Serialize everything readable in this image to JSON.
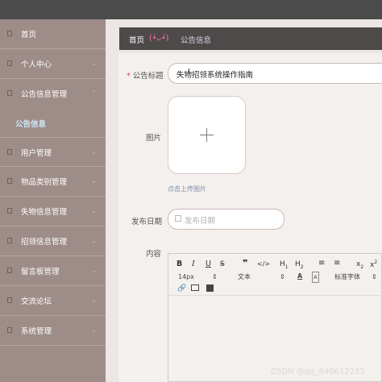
{
  "sidebar": {
    "items": [
      {
        "label": "首页",
        "icon": "home-icon"
      },
      {
        "label": "个人中心",
        "icon": "user-icon"
      },
      {
        "label": "公告信息管理",
        "icon": "notice-icon"
      },
      {
        "label": "用户管理",
        "icon": "users-icon"
      },
      {
        "label": "物品类别管理",
        "icon": "category-icon"
      },
      {
        "label": "失物信息管理",
        "icon": "lost-icon"
      },
      {
        "label": "招领信息管理",
        "icon": "found-icon"
      },
      {
        "label": "留言板管理",
        "icon": "message-icon"
      },
      {
        "label": "交流论坛",
        "icon": "forum-icon"
      },
      {
        "label": "系统管理",
        "icon": "settings-icon"
      }
    ],
    "sub_item": "公告信息"
  },
  "breadcrumb": {
    "home": "首页",
    "face": "(•̀ᴗ•́)",
    "current": "公告信息"
  },
  "form": {
    "title_label": "公告标题",
    "title_value": "失物招领系统操作指南",
    "image_label": "图片",
    "upload_hint": "点击上传图片",
    "date_label": "发布日期",
    "date_placeholder": "发布日期",
    "content_label": "内容"
  },
  "editor": {
    "font_size": "14px",
    "text_style": "文本",
    "font_family": "标准字体"
  },
  "watermark": "CSDN @qq_840612233"
}
